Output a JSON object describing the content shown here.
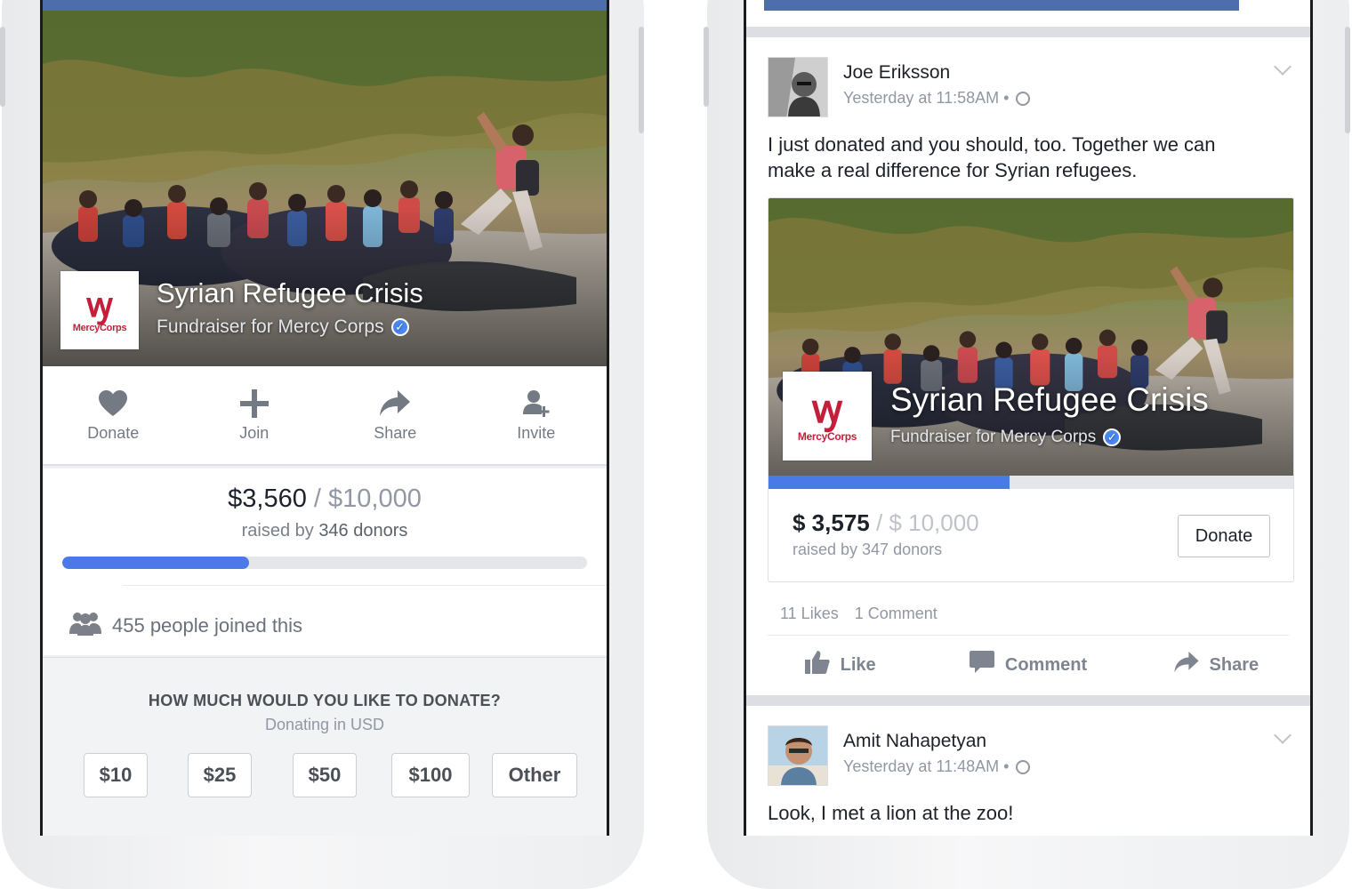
{
  "left_screen": {
    "fundraiser": {
      "title": "Syrian Refugee Crisis",
      "subtitle": "Fundraiser for Mercy Corps",
      "org_logo_text": "MercyCorps"
    },
    "actions": [
      {
        "label": "Donate",
        "icon": "heart-icon"
      },
      {
        "label": "Join",
        "icon": "plus-icon"
      },
      {
        "label": "Share",
        "icon": "share-arrow-icon"
      },
      {
        "label": "Invite",
        "icon": "add-person-icon"
      }
    ],
    "progress": {
      "raised": "$3,560",
      "separator": " / ",
      "goal": "$10,000",
      "raised_by_prefix": "raised by ",
      "donors": "346 donors",
      "fraction": 0.356
    },
    "joined_text": "455 people joined this",
    "donate_prompt": {
      "question": "HOW MUCH WOULD YOU LIKE TO DONATE?",
      "currency_note": "Donating in USD",
      "amounts": [
        "$10",
        "$25",
        "$50",
        "$100",
        "Other"
      ]
    }
  },
  "right_screen": {
    "post1": {
      "author": "Joe Eriksson",
      "time": "Yesterday at 11:58AM •",
      "text": "I just donated and you should, too. Together we can make a real difference for Syrian refugees.",
      "card": {
        "title": "Syrian Refugee Crisis",
        "subtitle": "Fundraiser for Mercy Corps",
        "org_logo_text": "MercyCorps",
        "raised": "$ 3,575",
        "separator": " / ",
        "goal": "$ 10,000",
        "raised_by": "raised by 347 donors",
        "donate_label": "Donate",
        "fraction": 0.46
      },
      "likes": "11 Likes",
      "comments": "1 Comment",
      "reactions": [
        {
          "label": "Like",
          "icon": "thumbs-up-icon"
        },
        {
          "label": "Comment",
          "icon": "comment-bubble-icon"
        },
        {
          "label": "Share",
          "icon": "share-arrow-icon"
        }
      ]
    },
    "post2": {
      "author": "Amit Nahapetyan",
      "time": "Yesterday at 11:48AM •",
      "text": "Look, I met a lion at the zoo!"
    }
  },
  "colors": {
    "facebook_blue": "#4e6dad",
    "progress_blue": "#4a7ae8",
    "mercy_corps_red": "#c41e3a",
    "verified_blue": "#4a88f0"
  }
}
